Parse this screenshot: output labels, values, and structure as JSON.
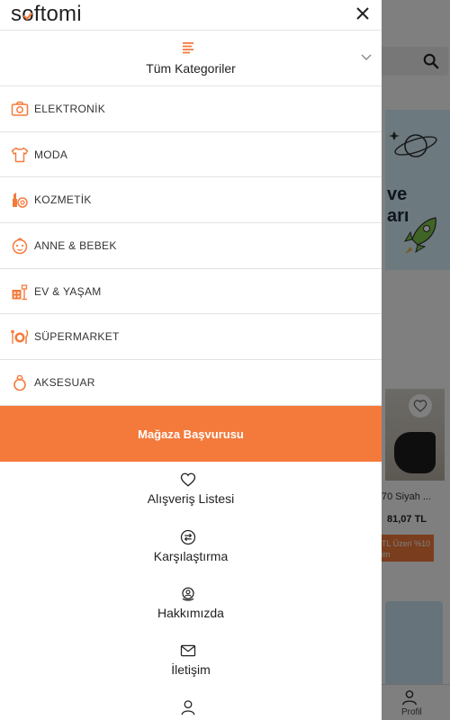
{
  "drawer": {
    "logo": "softomi",
    "categories_header": "Tüm Kategoriler",
    "categories": [
      {
        "label": "ELEKTRONİK",
        "icon": "camera-icon"
      },
      {
        "label": "MODA",
        "icon": "tshirt-icon"
      },
      {
        "label": "KOZMETİK",
        "icon": "cosmetics-icon"
      },
      {
        "label": "ANNE & BEBEK",
        "icon": "baby-icon"
      },
      {
        "label": "EV & YAŞAM",
        "icon": "home-living-icon"
      },
      {
        "label": "SÜPERMARKET",
        "icon": "supermarket-icon"
      },
      {
        "label": "AKSESUAR",
        "icon": "ring-icon"
      }
    ],
    "store_application_button": "Mağaza Başvurusu",
    "links": [
      {
        "label": "Alışveriş Listesi",
        "icon": "heart-icon"
      },
      {
        "label": "Karşılaştırma",
        "icon": "compare-icon"
      },
      {
        "label": "Hakkımızda",
        "icon": "about-icon"
      },
      {
        "label": "İletişim",
        "icon": "mail-icon"
      },
      {
        "label": "",
        "icon": "user-icon"
      }
    ]
  },
  "background": {
    "banner_line1": "ve",
    "banner_line2": "arı",
    "product_title": "70 Siyah ...",
    "product_price": "81,07 TL",
    "promo_line1": "TL Üzeri %10",
    "promo_line2": "im",
    "profile_label": "Profil"
  },
  "colors": {
    "accent": "#f47a3b",
    "overlay": "rgba(0,0,0,0.5)"
  }
}
